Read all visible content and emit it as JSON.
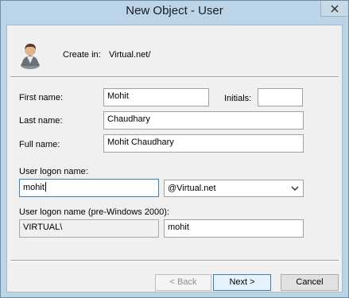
{
  "window": {
    "title": "New Object - User"
  },
  "header": {
    "create_in_label": "Create in:",
    "create_in_value": "Virtual.net/",
    "icon": "user-icon"
  },
  "form": {
    "first_name_label": "First name:",
    "first_name_value": "Mohit",
    "initials_label": "Initials:",
    "initials_value": "",
    "last_name_label": "Last name:",
    "last_name_value": "Chaudhary",
    "full_name_label": "Full name:",
    "full_name_value": "Mohit Chaudhary",
    "logon_name_label": "User logon name:",
    "logon_name_value": "mohit",
    "domain_suffix_value": "@Virtual.net",
    "pre2000_label": "User logon name (pre-Windows 2000):",
    "pre2000_domain_value": "VIRTUAL\\",
    "pre2000_name_value": "mohit"
  },
  "buttons": {
    "back_label": "< Back",
    "next_label": "Next >",
    "cancel_label": "Cancel"
  },
  "colors": {
    "frame": "#bcd4e8",
    "focus_border": "#3c7fb1",
    "client_bg": "#f0f0f0"
  }
}
